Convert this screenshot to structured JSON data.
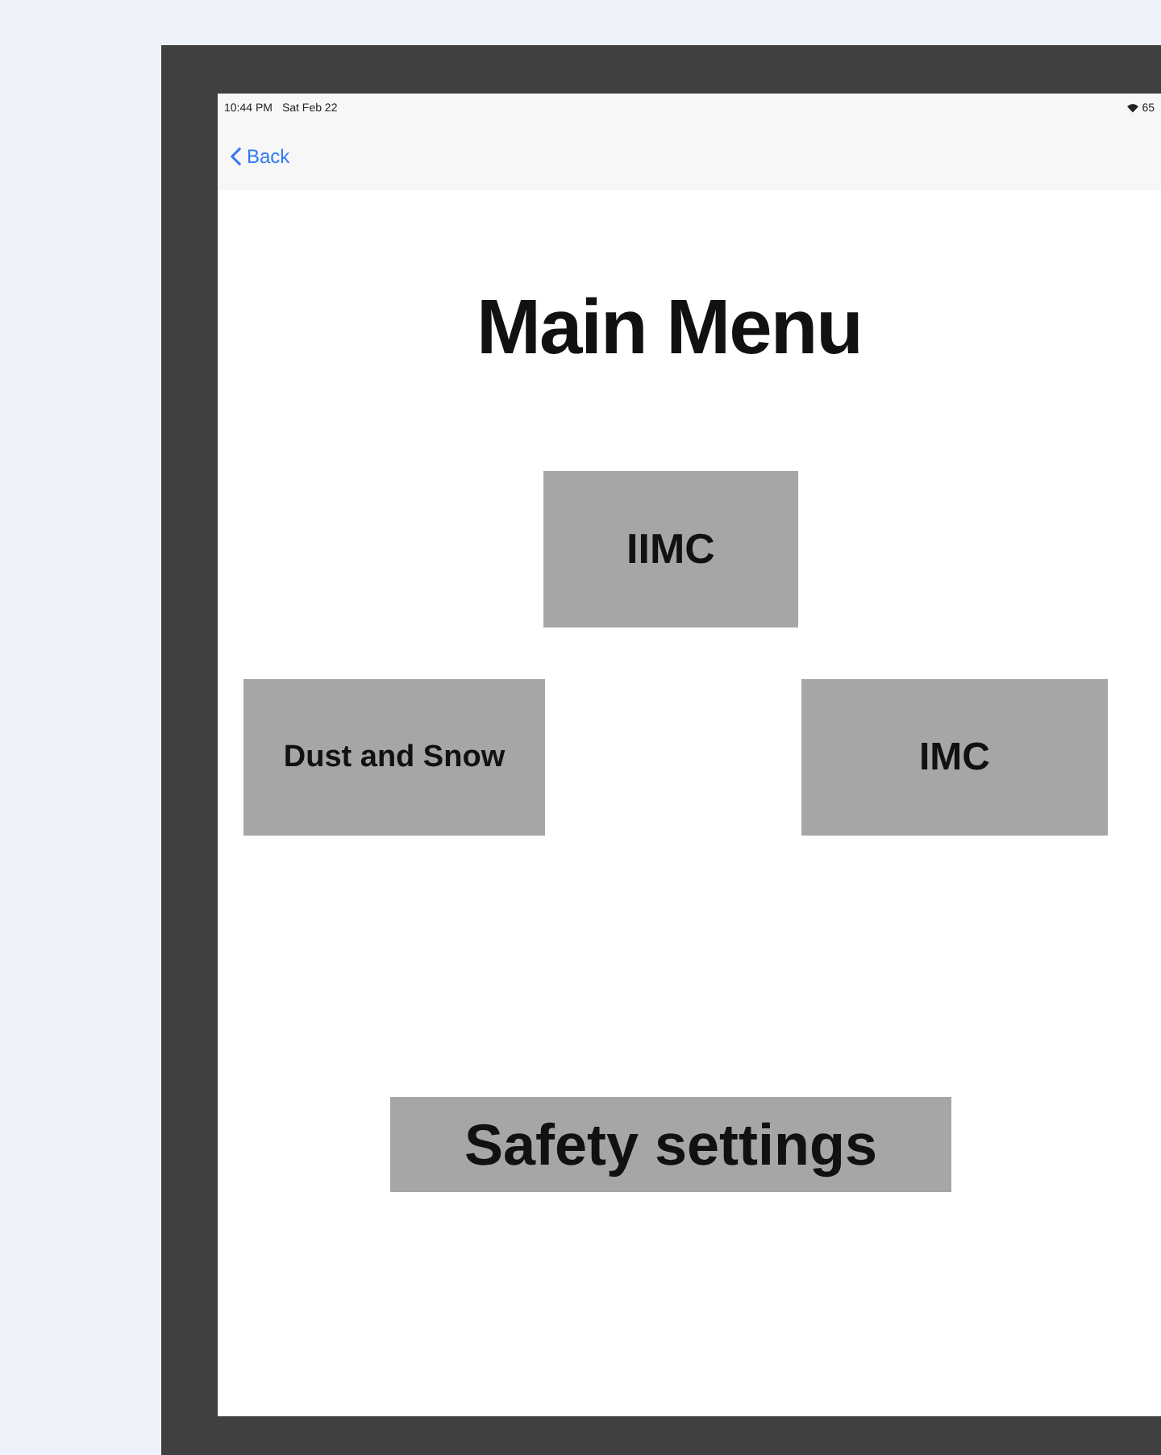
{
  "status_bar": {
    "time": "10:44 PM",
    "date": "Sat Feb 22",
    "battery": "65"
  },
  "nav": {
    "back": "Back"
  },
  "title": "Main Menu",
  "buttons": [
    {
      "label": "IIMC"
    },
    {
      "label": "Dust and Snow"
    },
    {
      "label": "IMC"
    },
    {
      "label": "Safety settings"
    }
  ]
}
